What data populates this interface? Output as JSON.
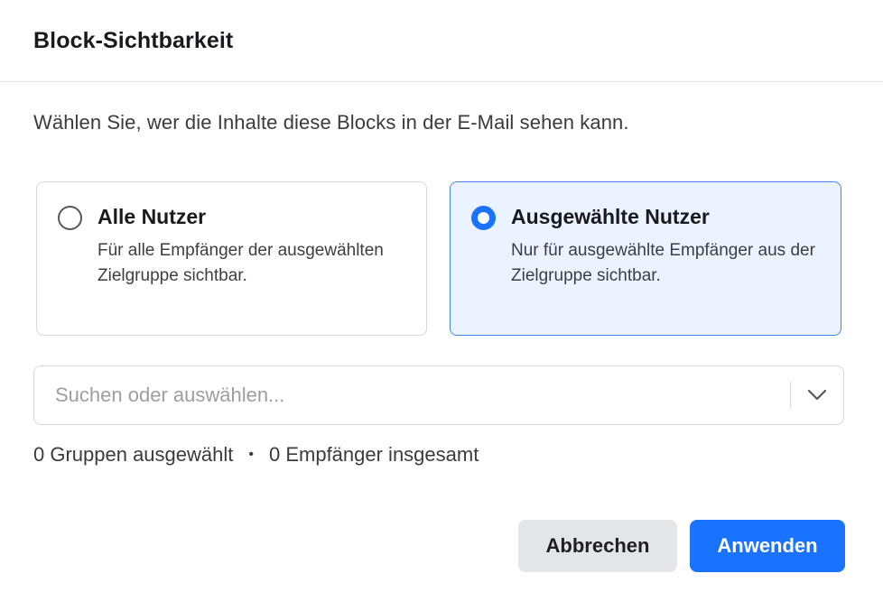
{
  "dialog": {
    "title": "Block-Sichtbarkeit",
    "description": "Wählen Sie, wer die Inhalte diese Blocks in der E-Mail sehen kann."
  },
  "options": [
    {
      "title": "Alle Nutzer",
      "description": "Für alle Empfänger der ausgewählten Zielgruppe sichtbar.",
      "selected": false
    },
    {
      "title": "Ausgewählte Nutzer",
      "description": "Nur für ausgewählte Empfänger aus der Zielgruppe sichtbar.",
      "selected": true
    }
  ],
  "search": {
    "placeholder": "Suchen oder auswählen...",
    "value": ""
  },
  "summary": {
    "groups": "0 Gruppen ausgewählt",
    "separator": "•",
    "recipients": "0 Empfänger insgesamt"
  },
  "buttons": {
    "cancel": "Abbrechen",
    "apply": "Anwenden"
  },
  "colors": {
    "accent": "#1a73ff",
    "selected_card_bg": "#eaf3ff",
    "selected_card_border": "#3f86f0"
  },
  "icons": {
    "dropdown": "chevron-down-icon"
  }
}
